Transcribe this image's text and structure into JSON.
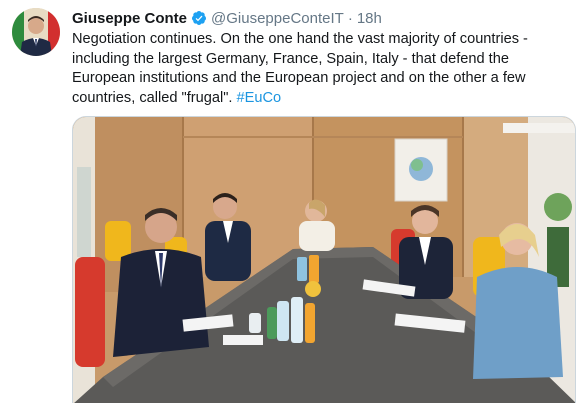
{
  "tweet": {
    "author_name": "Giuseppe Conte",
    "handle": "@GiuseppeConteIT",
    "separator": "·",
    "time": "18h",
    "verified_icon": "verified-badge-icon",
    "text_main": "Negotiation continues. On the one hand the vast majority of countries - including the largest Germany, France, Spain, Italy - that defend the European institutions and the European project and on the other a few countries, called \"frugal\". ",
    "hashtag": "#EuCo"
  },
  "media": {
    "kind": "photo"
  },
  "colors": {
    "link": "#1b95e0",
    "verified": "#1da1f2",
    "text": "#14171a",
    "muted": "#657786"
  }
}
